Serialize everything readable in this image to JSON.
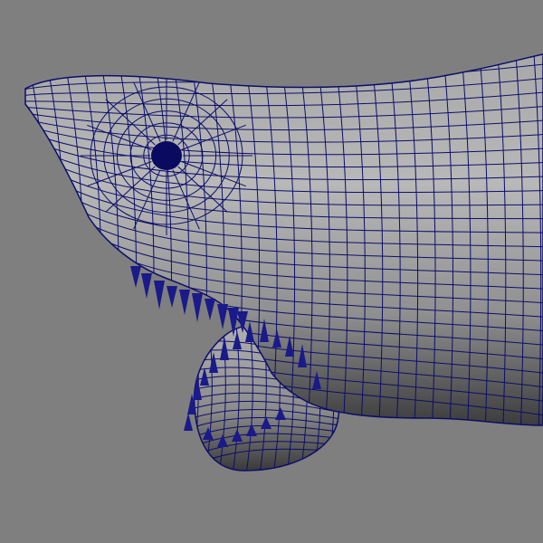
{
  "viewport": {
    "background_color": "#7f7f7f",
    "wireframe_color": "#0d0d6b",
    "object": "shark-head-mesh",
    "shading": "smooth-shaded-with-wireframe"
  },
  "colors": {
    "mesh_light": "#b5b5b5",
    "mesh_mid": "#8c8c8c",
    "mesh_dark": "#3a3a3a",
    "teeth": "#1a1a8a",
    "eye": "#0a0a60"
  }
}
